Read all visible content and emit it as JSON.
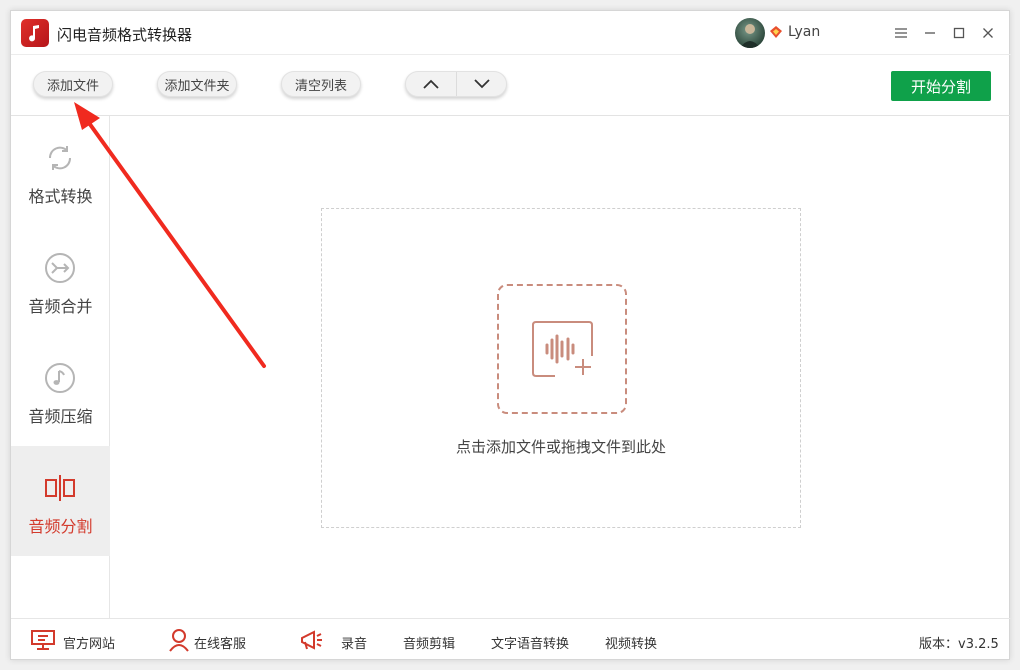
{
  "app": {
    "title": "闪电音频格式转换器"
  },
  "user": {
    "name": "Lyan"
  },
  "toolbar": {
    "add_file": "添加文件",
    "add_folder": "添加文件夹",
    "clear_list": "清空列表",
    "start_label": "开始分割"
  },
  "sidebar": {
    "items": [
      {
        "label": "格式转换",
        "icon": "refresh-icon",
        "active": false
      },
      {
        "label": "音频合并",
        "icon": "merge-icon",
        "active": false
      },
      {
        "label": "音频压缩",
        "icon": "music-note-icon",
        "active": false
      },
      {
        "label": "音频分割",
        "icon": "split-icon",
        "active": true
      }
    ]
  },
  "dropzone": {
    "hint": "点击添加文件或拖拽文件到此处"
  },
  "footer": {
    "official_site": "官方网站",
    "online_service": "在线客服",
    "record": "录音",
    "audio_edit": "音频剪辑",
    "tts": "文字语音转换",
    "video_convert": "视频转换",
    "version": "版本：v3.2.5"
  },
  "colors": {
    "accent_red": "#d33a2c",
    "start_green": "#0fa14a",
    "dropzone_dash": "#c98c7d"
  }
}
